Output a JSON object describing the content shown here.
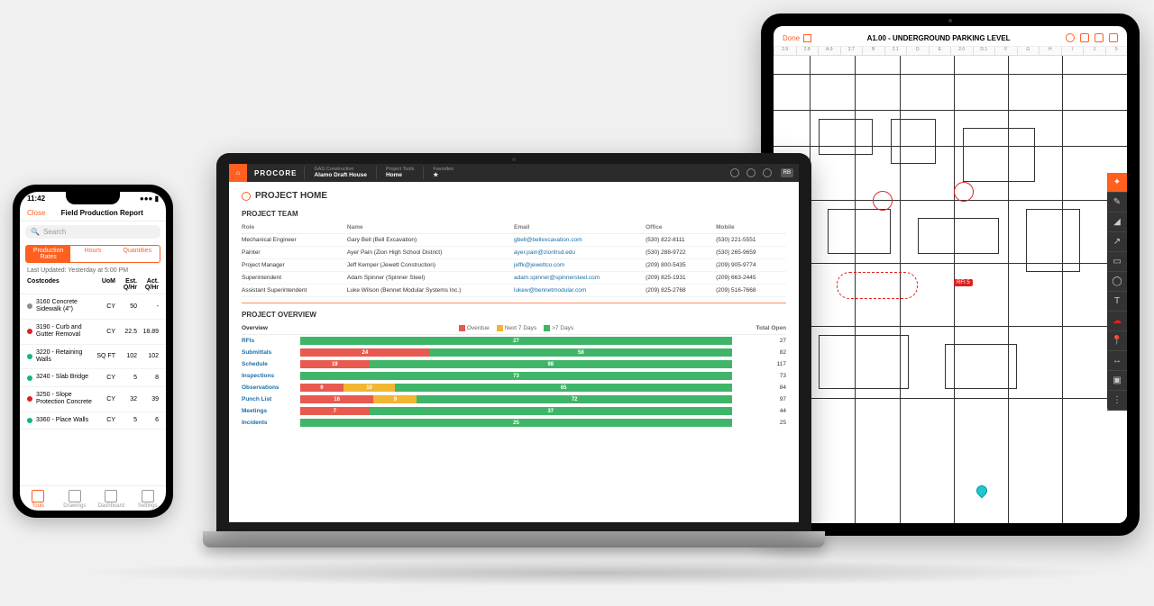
{
  "phone": {
    "time": "11:42",
    "close": "Close",
    "title": "Field Production Report",
    "search_placeholder": "Search",
    "tabs": [
      "Production Rates",
      "Hours",
      "Quantities"
    ],
    "updated": "Last Updated: Yesterday at 5:00 PM",
    "cols": {
      "c1": "Costcodes",
      "c2": "UoM",
      "c3": "Est. Q/Hr",
      "c4": "Act. Q/Hr"
    },
    "rows": [
      {
        "dot": "#8c8c8c",
        "name": "3160 Concrete Sidewalk (4\")",
        "uom": "CY",
        "est": "50",
        "act": "-"
      },
      {
        "dot": "#e02020",
        "name": "3190 - Curb and Gutter Removal",
        "uom": "CY",
        "est": "22.5",
        "act": "18.89"
      },
      {
        "dot": "#12b386",
        "name": "3220 - Retaining Walls",
        "uom": "SQ FT",
        "est": "102",
        "act": "102"
      },
      {
        "dot": "#12b386",
        "name": "3240 - Slab Bridge",
        "uom": "CY",
        "est": "5",
        "act": "8"
      },
      {
        "dot": "#e02020",
        "name": "3250 - Slope Protection Concrete",
        "uom": "CY",
        "est": "32",
        "act": "39"
      },
      {
        "dot": "#12b386",
        "name": "3360 - Place Walls",
        "uom": "CY",
        "est": "5",
        "act": "6"
      }
    ],
    "nav": [
      "Tools",
      "Drawings",
      "Dashboard",
      "Settings"
    ]
  },
  "laptop": {
    "brand": "PROCORE",
    "company_label": "GAS Construction",
    "company_value": "Alamo Draft House",
    "tools_label": "Project Tools",
    "tools_value": "Home",
    "fav_label": "Favorites",
    "avatar": "RB",
    "page_title": "PROJECT HOME",
    "team_title": "PROJECT TEAM",
    "team_head": {
      "role": "Role",
      "name": "Name",
      "email": "Email",
      "office": "Office",
      "mobile": "Mobile"
    },
    "team": [
      {
        "role": "Mechanical Engineer",
        "name": "Gary Bell (Bell Excavation)",
        "email": "gbell@bellexcavation.com",
        "office": "(530) 822-8111",
        "mobile": "(530) 221-5551"
      },
      {
        "role": "Painter",
        "name": "Ayer Pain (Zion High School District)",
        "email": "ayer.pain@zionhsd.edu",
        "office": "(530) 288-9722",
        "mobile": "(530) 265-9659"
      },
      {
        "role": "Project Manager",
        "name": "Jeff Kemper (Jewett Construction)",
        "email": "jeffk@jewettco.com",
        "office": "(209) 800-5435",
        "mobile": "(209) 905-9774"
      },
      {
        "role": "Superintendent",
        "name": "Adam Spinner (Spinner Steel)",
        "email": "adam.spinner@spinnersteel.com",
        "office": "(209) 825-1931",
        "mobile": "(209) 663-2445"
      },
      {
        "role": "Assistant Superintendent",
        "name": "Luke Wilson (Bennet Modular Systems Inc.)",
        "email": "lukew@bennetmodular.com",
        "office": "(209) 825-2768",
        "mobile": "(209) 516-7668"
      }
    ],
    "overview_title": "PROJECT OVERVIEW",
    "overview_head": "Overview",
    "legend": {
      "overdue": "Overdue",
      "next7": "Next 7 Days",
      "gt7": ">7 Days"
    },
    "total_label": "Total Open",
    "colors": {
      "overdue": "#e85a4f",
      "next7": "#f2b632",
      "ok": "#3fb568"
    },
    "overview": [
      {
        "name": "RFIs",
        "overdue": 0,
        "next7": 0,
        "ok_label": "27",
        "total": "27"
      },
      {
        "name": "Submittals",
        "overdue": 30,
        "next7": 0,
        "ov_label": "24",
        "ok_label": "58",
        "total": "82"
      },
      {
        "name": "Schedule",
        "overdue": 16,
        "next7": 0,
        "ov_label": "19",
        "ok_label": "98",
        "total": "117"
      },
      {
        "name": "Inspections",
        "overdue": 0,
        "next7": 0,
        "ok_label": "73",
        "total": "73"
      },
      {
        "name": "Observations",
        "overdue": 10,
        "next7": 12,
        "ov_label": "9",
        "n7_label": "10",
        "ok_label": "65",
        "total": "84"
      },
      {
        "name": "Punch List",
        "overdue": 17,
        "next7": 10,
        "ov_label": "16",
        "n7_label": "9",
        "ok_label": "72",
        "total": "97"
      },
      {
        "name": "Meetings",
        "overdue": 16,
        "next7": 0,
        "ov_label": "7",
        "ok_label": "37",
        "total": "44"
      },
      {
        "name": "Incidents",
        "overdue": 0,
        "next7": 0,
        "ok_label": "25",
        "total": "25"
      }
    ]
  },
  "tablet": {
    "done": "Done",
    "title": "A1.00 - UNDERGROUND PARKING LEVEL",
    "ruler": [
      "2.9",
      "2.8",
      "A.9",
      "2.7",
      "B",
      "2.1",
      "D",
      "E",
      "2.0",
      "D.1",
      "F",
      "G",
      "H",
      "I",
      "J",
      "5"
    ],
    "tag": "RFI 5"
  }
}
